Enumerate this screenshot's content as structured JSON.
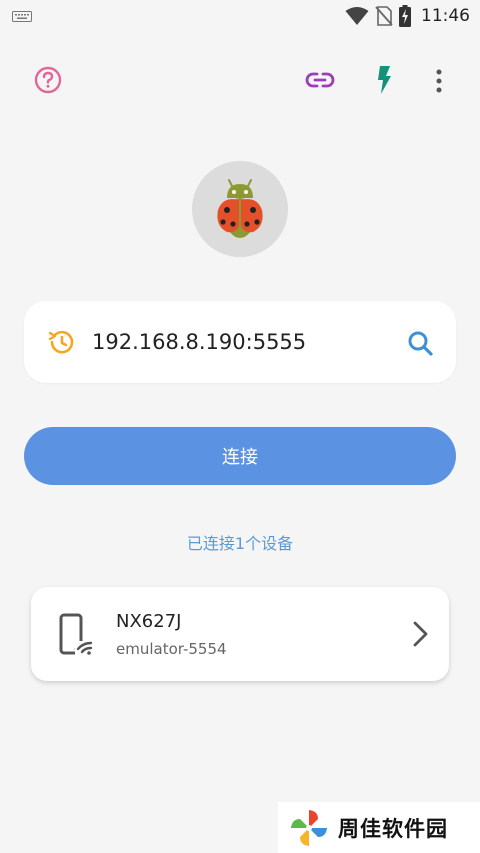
{
  "status_bar": {
    "time": "11:46",
    "icons": [
      "keyboard-icon",
      "wifi-icon",
      "no-sim-icon",
      "battery-charging-icon"
    ]
  },
  "toolbar": {
    "icons": [
      "help-icon",
      "link-icon",
      "flash-icon",
      "more-vertical-icon"
    ],
    "colors": {
      "help": "#e0679a",
      "link": "#9b3fb8",
      "flash": "#12937a",
      "more": "#555555"
    }
  },
  "logo": {
    "icon": "ladybug-android-logo"
  },
  "address_bar": {
    "value": "192.168.8.190:5555",
    "history_icon": "history-icon",
    "search_icon": "search-icon",
    "colors": {
      "history": "#f5a623",
      "search": "#3d8fd8"
    }
  },
  "connect_button": {
    "label": "连接",
    "color": "#5b93e2"
  },
  "connected_status": {
    "text": "已连接1个设备"
  },
  "devices": [
    {
      "name": "NX627J",
      "serial": "emulator-5554",
      "icon": "phone-wifi-icon"
    }
  ],
  "watermark": {
    "text": "周佳软件园"
  }
}
